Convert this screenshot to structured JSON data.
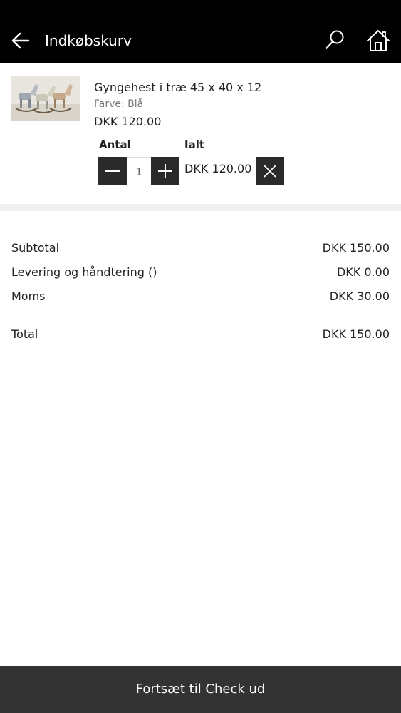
{
  "header": {
    "title": "Indkøbskurv"
  },
  "item": {
    "name": "Gyngehest i træ 45 x 40 x 12",
    "variant": "Farve: Blå",
    "price": "DKK 120.00",
    "qty_label": "Antal",
    "total_label": "Ialt",
    "quantity": "1",
    "line_total": "DKK 120.00"
  },
  "summary": {
    "rows": [
      {
        "label": "Subtotal",
        "value": "DKK 150.00"
      },
      {
        "label": "Levering og håndtering ()",
        "value": "DKK 0.00"
      },
      {
        "label": "Moms",
        "value": "DKK 30.00"
      }
    ],
    "total": {
      "label": "Total",
      "value": "DKK 150.00"
    }
  },
  "footer": {
    "checkout_label": "Fortsæt til Check ud"
  },
  "colors": {
    "header_bg": "#000000",
    "footer_bg": "#333333",
    "stepper_bg": "#2a2a2a"
  },
  "icons": [
    "back-arrow-icon",
    "search-icon",
    "home-icon",
    "minus-icon",
    "plus-icon",
    "close-icon"
  ]
}
